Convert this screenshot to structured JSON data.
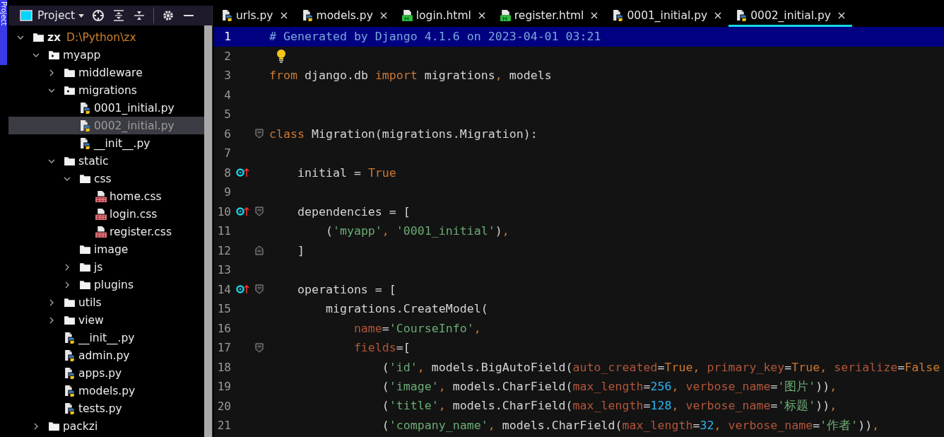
{
  "side_strip": {
    "label": "Project"
  },
  "project_panel": {
    "title": "Project",
    "tree": [
      {
        "kind": "root",
        "label": "zx",
        "path": "D:\\Python\\zx",
        "expanded": true,
        "selected": false,
        "children": [
          {
            "kind": "package",
            "label": "myapp",
            "expanded": true,
            "selected": false,
            "children": [
              {
                "kind": "folder",
                "label": "middleware",
                "expanded": false,
                "selected": false
              },
              {
                "kind": "package",
                "label": "migrations",
                "expanded": true,
                "selected": false,
                "children": [
                  {
                    "kind": "py",
                    "label": "0001_initial.py",
                    "selected": false
                  },
                  {
                    "kind": "py",
                    "label": "0002_initial.py",
                    "selected": true
                  },
                  {
                    "kind": "py",
                    "label": "__init__.py",
                    "selected": false
                  }
                ]
              },
              {
                "kind": "folder",
                "label": "static",
                "expanded": true,
                "selected": false,
                "children": [
                  {
                    "kind": "folder",
                    "label": "css",
                    "expanded": true,
                    "selected": false,
                    "children": [
                      {
                        "kind": "css",
                        "label": "home.css",
                        "selected": false
                      },
                      {
                        "kind": "css",
                        "label": "login.css",
                        "selected": false
                      },
                      {
                        "kind": "css",
                        "label": "register.css",
                        "selected": false
                      }
                    ]
                  },
                  {
                    "kind": "folder",
                    "label": "image",
                    "selected": false
                  },
                  {
                    "kind": "folder",
                    "label": "js",
                    "expanded": false,
                    "selected": false
                  },
                  {
                    "kind": "folder",
                    "label": "plugins",
                    "expanded": false,
                    "selected": false
                  }
                ]
              },
              {
                "kind": "folder",
                "label": "utils",
                "expanded": false,
                "selected": false
              },
              {
                "kind": "folder",
                "label": "view",
                "expanded": false,
                "selected": false
              },
              {
                "kind": "py",
                "label": "__init__.py",
                "selected": false
              },
              {
                "kind": "py",
                "label": "admin.py",
                "selected": false
              },
              {
                "kind": "py",
                "label": "apps.py",
                "selected": false
              },
              {
                "kind": "py",
                "label": "models.py",
                "selected": false
              },
              {
                "kind": "py",
                "label": "tests.py",
                "selected": false
              }
            ]
          },
          {
            "kind": "folder",
            "label": "packzi",
            "expanded": false,
            "selected": false
          }
        ]
      }
    ]
  },
  "tabs": [
    {
      "kind": "py",
      "label": "urls.py",
      "selected": false
    },
    {
      "kind": "py",
      "label": "models.py",
      "selected": false
    },
    {
      "kind": "html",
      "label": "login.html",
      "selected": false
    },
    {
      "kind": "html",
      "label": "register.html",
      "selected": false
    },
    {
      "kind": "py",
      "label": "0001_initial.py",
      "selected": false
    },
    {
      "kind": "py",
      "label": "0002_initial.py",
      "selected": true
    }
  ],
  "editor": {
    "lines": [
      {
        "number": "1",
        "current": true,
        "tokens": [
          {
            "kind": "comment",
            "text": "# Generated by Django 4.1.6 on 2023-04-01 03:21"
          }
        ]
      },
      {
        "number": "2",
        "current": false,
        "bulb": true
      },
      {
        "number": "3",
        "current": false,
        "tokens": [
          {
            "kind": "keyword",
            "text": "from"
          },
          {
            "kind": "plain",
            "text": " django.db "
          },
          {
            "kind": "keyword",
            "text": "import"
          },
          {
            "kind": "plain",
            "text": " migrations"
          },
          {
            "kind": "keyword",
            "text": ","
          },
          {
            "kind": "plain",
            "text": " models"
          }
        ]
      },
      {
        "number": "4",
        "current": false
      },
      {
        "number": "5",
        "current": false
      },
      {
        "number": "6",
        "current": false,
        "fold_start": true,
        "tokens": [
          {
            "kind": "keyword",
            "text": "class"
          },
          {
            "kind": "plain",
            "text": " Migration(migrations.Migration):"
          }
        ]
      },
      {
        "number": "7",
        "current": false
      },
      {
        "number": "8",
        "current": false,
        "override": true,
        "tokens": [
          {
            "kind": "plain",
            "text": "    initial = "
          },
          {
            "kind": "keyword",
            "text": "True"
          }
        ]
      },
      {
        "number": "9",
        "current": false
      },
      {
        "number": "10",
        "current": false,
        "override": true,
        "fold_start": true,
        "tokens": [
          {
            "kind": "plain",
            "text": "    dependencies = ["
          }
        ]
      },
      {
        "number": "11",
        "current": false,
        "tokens": [
          {
            "kind": "plain",
            "text": "        ("
          },
          {
            "kind": "string",
            "text": "'myapp'"
          },
          {
            "kind": "keyword",
            "text": ", "
          },
          {
            "kind": "string",
            "text": "'0001_initial'"
          },
          {
            "kind": "plain",
            "text": ")"
          },
          {
            "kind": "keyword",
            "text": ","
          }
        ]
      },
      {
        "number": "12",
        "current": false,
        "fold_end": true,
        "tokens": [
          {
            "kind": "plain",
            "text": "    ]"
          }
        ]
      },
      {
        "number": "13",
        "current": false
      },
      {
        "number": "14",
        "current": false,
        "override": true,
        "fold_start": true,
        "tokens": [
          {
            "kind": "plain",
            "text": "    operations = ["
          }
        ]
      },
      {
        "number": "15",
        "current": false,
        "tokens": [
          {
            "kind": "plain",
            "text": "        migrations.CreateModel("
          }
        ]
      },
      {
        "number": "16",
        "current": false,
        "tokens": [
          {
            "kind": "param",
            "text": "            name"
          },
          {
            "kind": "plain",
            "text": "="
          },
          {
            "kind": "string",
            "text": "'CourseInfo'"
          },
          {
            "kind": "keyword",
            "text": ","
          }
        ]
      },
      {
        "number": "17",
        "current": false,
        "fold_start": true,
        "tokens": [
          {
            "kind": "param",
            "text": "            fields"
          },
          {
            "kind": "plain",
            "text": "=["
          }
        ]
      },
      {
        "number": "18",
        "current": false,
        "tokens": [
          {
            "kind": "plain",
            "text": "                ("
          },
          {
            "kind": "string",
            "text": "'id'"
          },
          {
            "kind": "keyword",
            "text": ", "
          },
          {
            "kind": "plain",
            "text": "models.BigAutoField("
          },
          {
            "kind": "param",
            "text": "auto_created"
          },
          {
            "kind": "plain",
            "text": "="
          },
          {
            "kind": "keyword",
            "text": "True"
          },
          {
            "kind": "keyword",
            "text": ", "
          },
          {
            "kind": "param",
            "text": "primary_key"
          },
          {
            "kind": "plain",
            "text": "="
          },
          {
            "kind": "keyword",
            "text": "True"
          },
          {
            "kind": "keyword",
            "text": ", "
          },
          {
            "kind": "param",
            "text": "serialize"
          },
          {
            "kind": "plain",
            "text": "="
          },
          {
            "kind": "keyword",
            "text": "False"
          }
        ]
      },
      {
        "number": "19",
        "current": false,
        "tokens": [
          {
            "kind": "plain",
            "text": "                ("
          },
          {
            "kind": "string",
            "text": "'image'"
          },
          {
            "kind": "keyword",
            "text": ", "
          },
          {
            "kind": "plain",
            "text": "models.CharField("
          },
          {
            "kind": "param",
            "text": "max_length"
          },
          {
            "kind": "plain",
            "text": "="
          },
          {
            "kind": "number",
            "text": "256"
          },
          {
            "kind": "keyword",
            "text": ", "
          },
          {
            "kind": "param",
            "text": "verbose_name"
          },
          {
            "kind": "plain",
            "text": "="
          },
          {
            "kind": "string",
            "text": "'图片'"
          },
          {
            "kind": "plain",
            "text": "))"
          },
          {
            "kind": "keyword",
            "text": ","
          }
        ]
      },
      {
        "number": "20",
        "current": false,
        "tokens": [
          {
            "kind": "plain",
            "text": "                ("
          },
          {
            "kind": "string",
            "text": "'title'"
          },
          {
            "kind": "keyword",
            "text": ", "
          },
          {
            "kind": "plain",
            "text": "models.CharField("
          },
          {
            "kind": "param",
            "text": "max_length"
          },
          {
            "kind": "plain",
            "text": "="
          },
          {
            "kind": "number",
            "text": "128"
          },
          {
            "kind": "keyword",
            "text": ", "
          },
          {
            "kind": "param",
            "text": "verbose_name"
          },
          {
            "kind": "plain",
            "text": "="
          },
          {
            "kind": "string",
            "text": "'标题'"
          },
          {
            "kind": "plain",
            "text": "))"
          },
          {
            "kind": "keyword",
            "text": ","
          }
        ]
      },
      {
        "number": "21",
        "current": false,
        "tokens": [
          {
            "kind": "plain",
            "text": "                ("
          },
          {
            "kind": "string",
            "text": "'company_name'"
          },
          {
            "kind": "keyword",
            "text": ", "
          },
          {
            "kind": "plain",
            "text": "models.CharField("
          },
          {
            "kind": "param",
            "text": "max_length"
          },
          {
            "kind": "plain",
            "text": "="
          },
          {
            "kind": "number",
            "text": "32"
          },
          {
            "kind": "keyword",
            "text": ", "
          },
          {
            "kind": "param",
            "text": "verbose_name"
          },
          {
            "kind": "plain",
            "text": "="
          },
          {
            "kind": "string",
            "text": "'作者'"
          },
          {
            "kind": "plain",
            "text": "))"
          },
          {
            "kind": "keyword",
            "text": ","
          }
        ]
      }
    ]
  }
}
